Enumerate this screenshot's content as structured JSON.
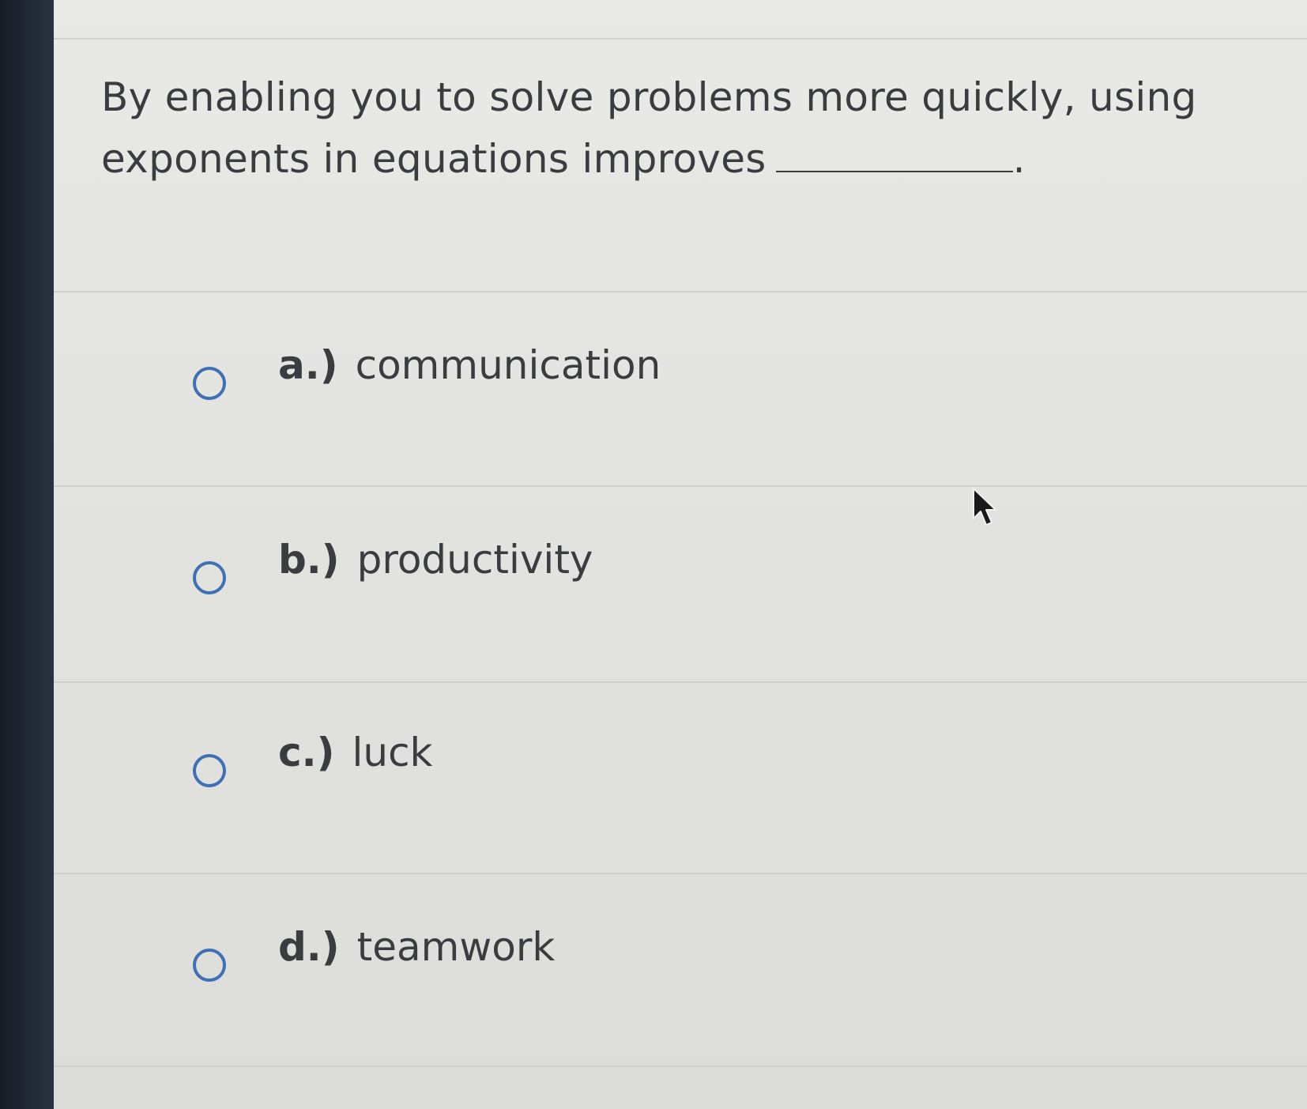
{
  "question": {
    "text": "By enabling you to solve problems more quickly, using exponents in equations improves",
    "end_punct": "."
  },
  "options": [
    {
      "letter": "a.)",
      "text": "communication"
    },
    {
      "letter": "b.)",
      "text": "productivity"
    },
    {
      "letter": "c.)",
      "text": "luck"
    },
    {
      "letter": "d.)",
      "text": "teamwork"
    }
  ],
  "colors": {
    "radio": "#3f6fb4",
    "text": "#3a3c40",
    "bezel": "#1c232e"
  },
  "icons": {
    "cursor": "mouse-pointer-icon",
    "radio": "radio-circle-icon"
  }
}
